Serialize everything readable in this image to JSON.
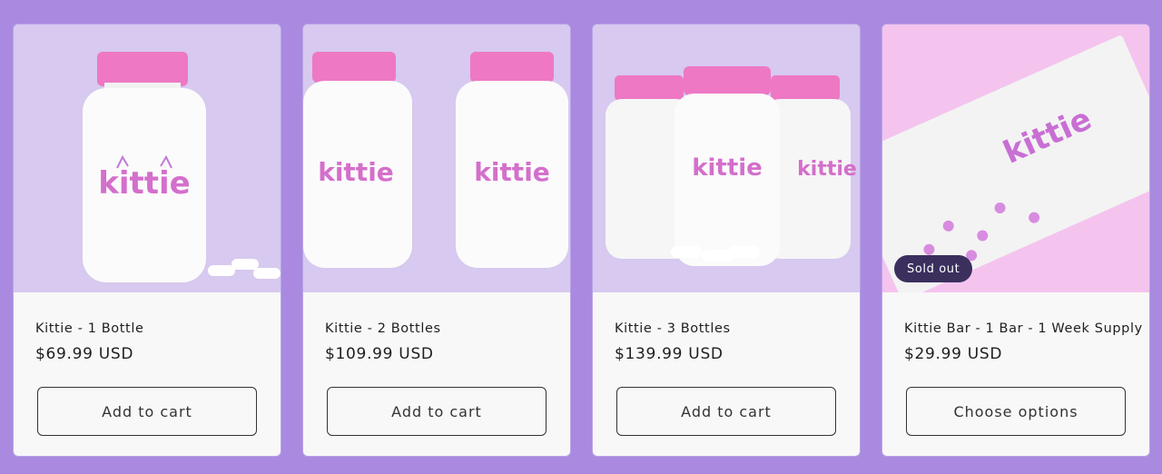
{
  "products": [
    {
      "title": "Kittie - 1 Bottle",
      "price": "$69.99 USD",
      "button": "Add to cart",
      "image_alt": "kittie",
      "badge": ""
    },
    {
      "title": "Kittie - 2 Bottles",
      "price": "$109.99 USD",
      "button": "Add to cart",
      "image_alt": "kittie",
      "badge": ""
    },
    {
      "title": "Kittie - 3 Bottles",
      "price": "$139.99 USD",
      "button": "Add to cart",
      "image_alt": "kittie",
      "badge": ""
    },
    {
      "title": "Kittie Bar - 1 Bar - 1 Week Supply",
      "price": "$29.99 USD",
      "button": "Choose options",
      "image_alt": "kittie",
      "badge": "Sold out"
    }
  ],
  "colors": {
    "page_background": "#a98ae0",
    "card_background": "#f8f8f8",
    "image_background": "#d7c9ef",
    "bar_background": "#f4c4ee",
    "cap_pink": "#ee78c4",
    "badge_background": "#3b2f5e"
  }
}
